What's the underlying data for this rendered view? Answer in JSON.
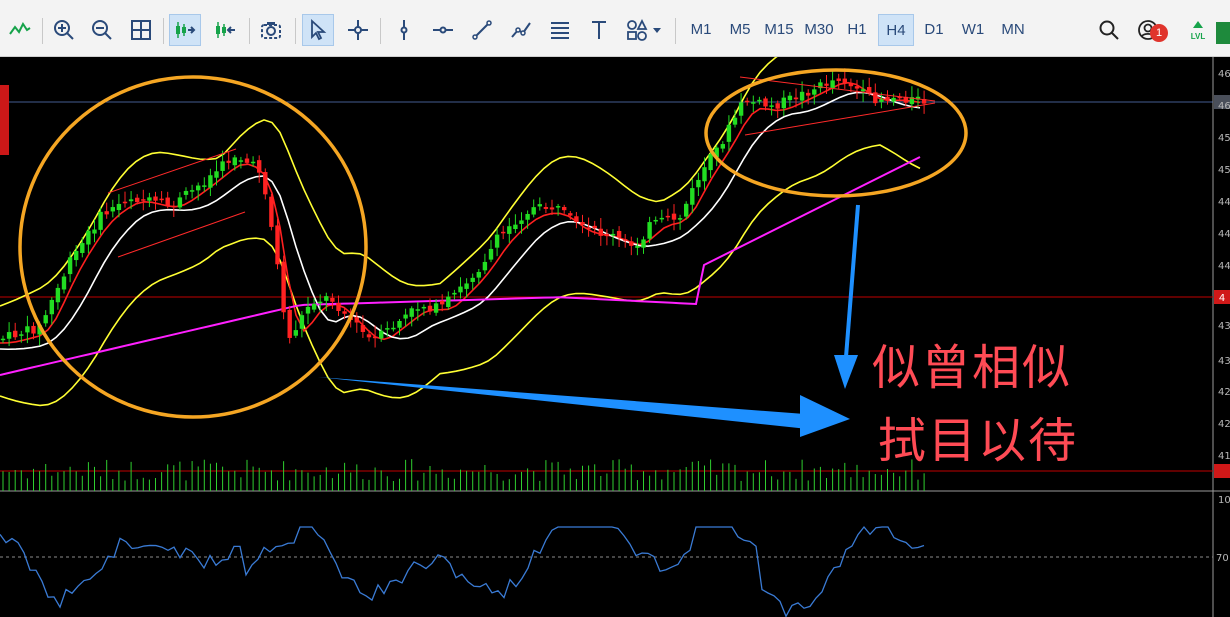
{
  "toolbar": {
    "timeframes": [
      "M1",
      "M5",
      "M15",
      "M30",
      "H1",
      "H4",
      "D1",
      "W1",
      "MN"
    ],
    "active_timeframe": "H4",
    "notification_count": "1",
    "lvl_label": "LVL"
  },
  "chart": {
    "callout_line1": "似曾相似",
    "callout_line2": "拭目以待"
  },
  "price_axis": {
    "labels": [
      "46",
      "46",
      "45",
      "45",
      "44",
      "44",
      "44",
      "43",
      "43",
      "42",
      "42",
      "41",
      "4"
    ],
    "current_price_tag": "4"
  },
  "oscillator_axis": {
    "labels": [
      "10",
      "70"
    ]
  },
  "colors": {
    "background": "#000000",
    "bull_candle": "#22dd22",
    "bear_candle": "#ff2222",
    "bollinger": "#ffff33",
    "ma_fast": "#ff2020",
    "ma_mid": "#ffffff",
    "ma_slow": "#ff20ff",
    "circle": "#f5a623",
    "arrow": "#1e90ff",
    "oscillator": "#3a7bd5",
    "callout_text": "#ff4b55"
  }
}
